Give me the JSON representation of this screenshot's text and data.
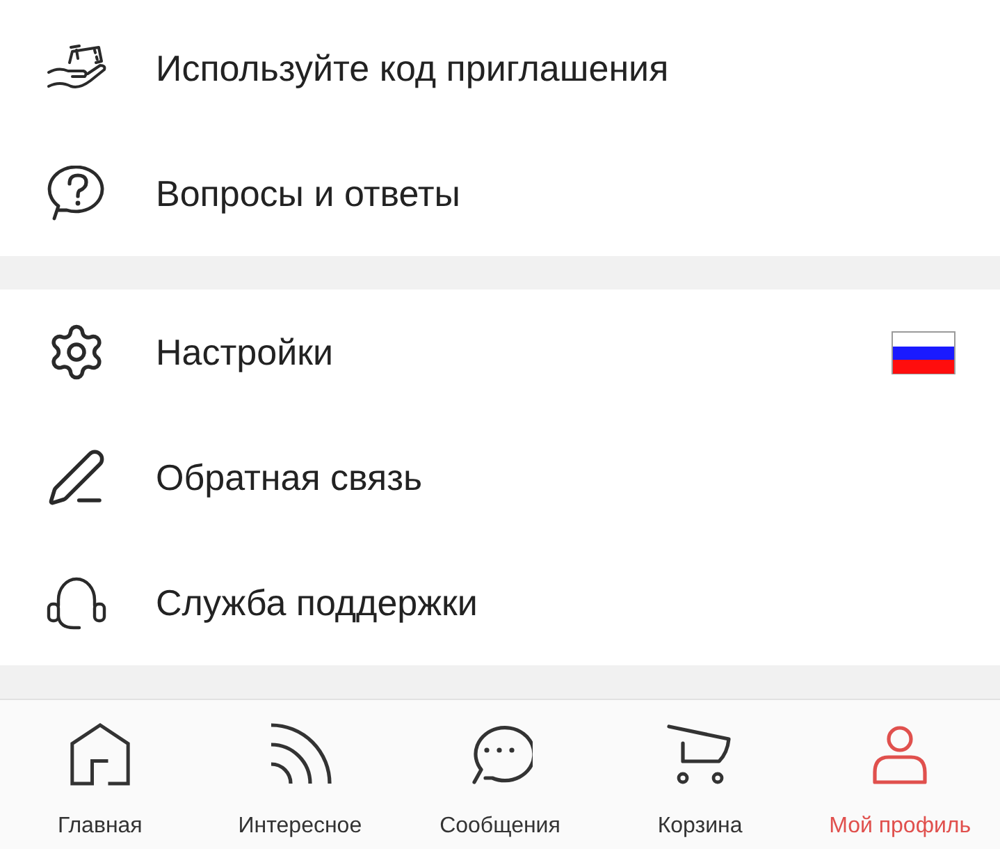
{
  "menu_sections": [
    {
      "items": [
        {
          "label": "Используйте код приглашения",
          "kind": "plain"
        },
        {
          "label": "Вопросы и ответы",
          "kind": "plain"
        }
      ]
    },
    {
      "items": [
        {
          "label": "Настройки",
          "kind": "flag"
        },
        {
          "label": "Обратная связь",
          "kind": "plain"
        },
        {
          "label": "Служба поддержки",
          "kind": "plain"
        }
      ]
    }
  ],
  "tab_bar": {
    "tabs": [
      {
        "label": "Главная",
        "selected": false
      },
      {
        "label": "Интересное",
        "selected": false
      },
      {
        "label": "Сообщения",
        "selected": false
      },
      {
        "label": "Корзина",
        "selected": false
      },
      {
        "label": "Мой профиль",
        "selected": true
      }
    ]
  }
}
